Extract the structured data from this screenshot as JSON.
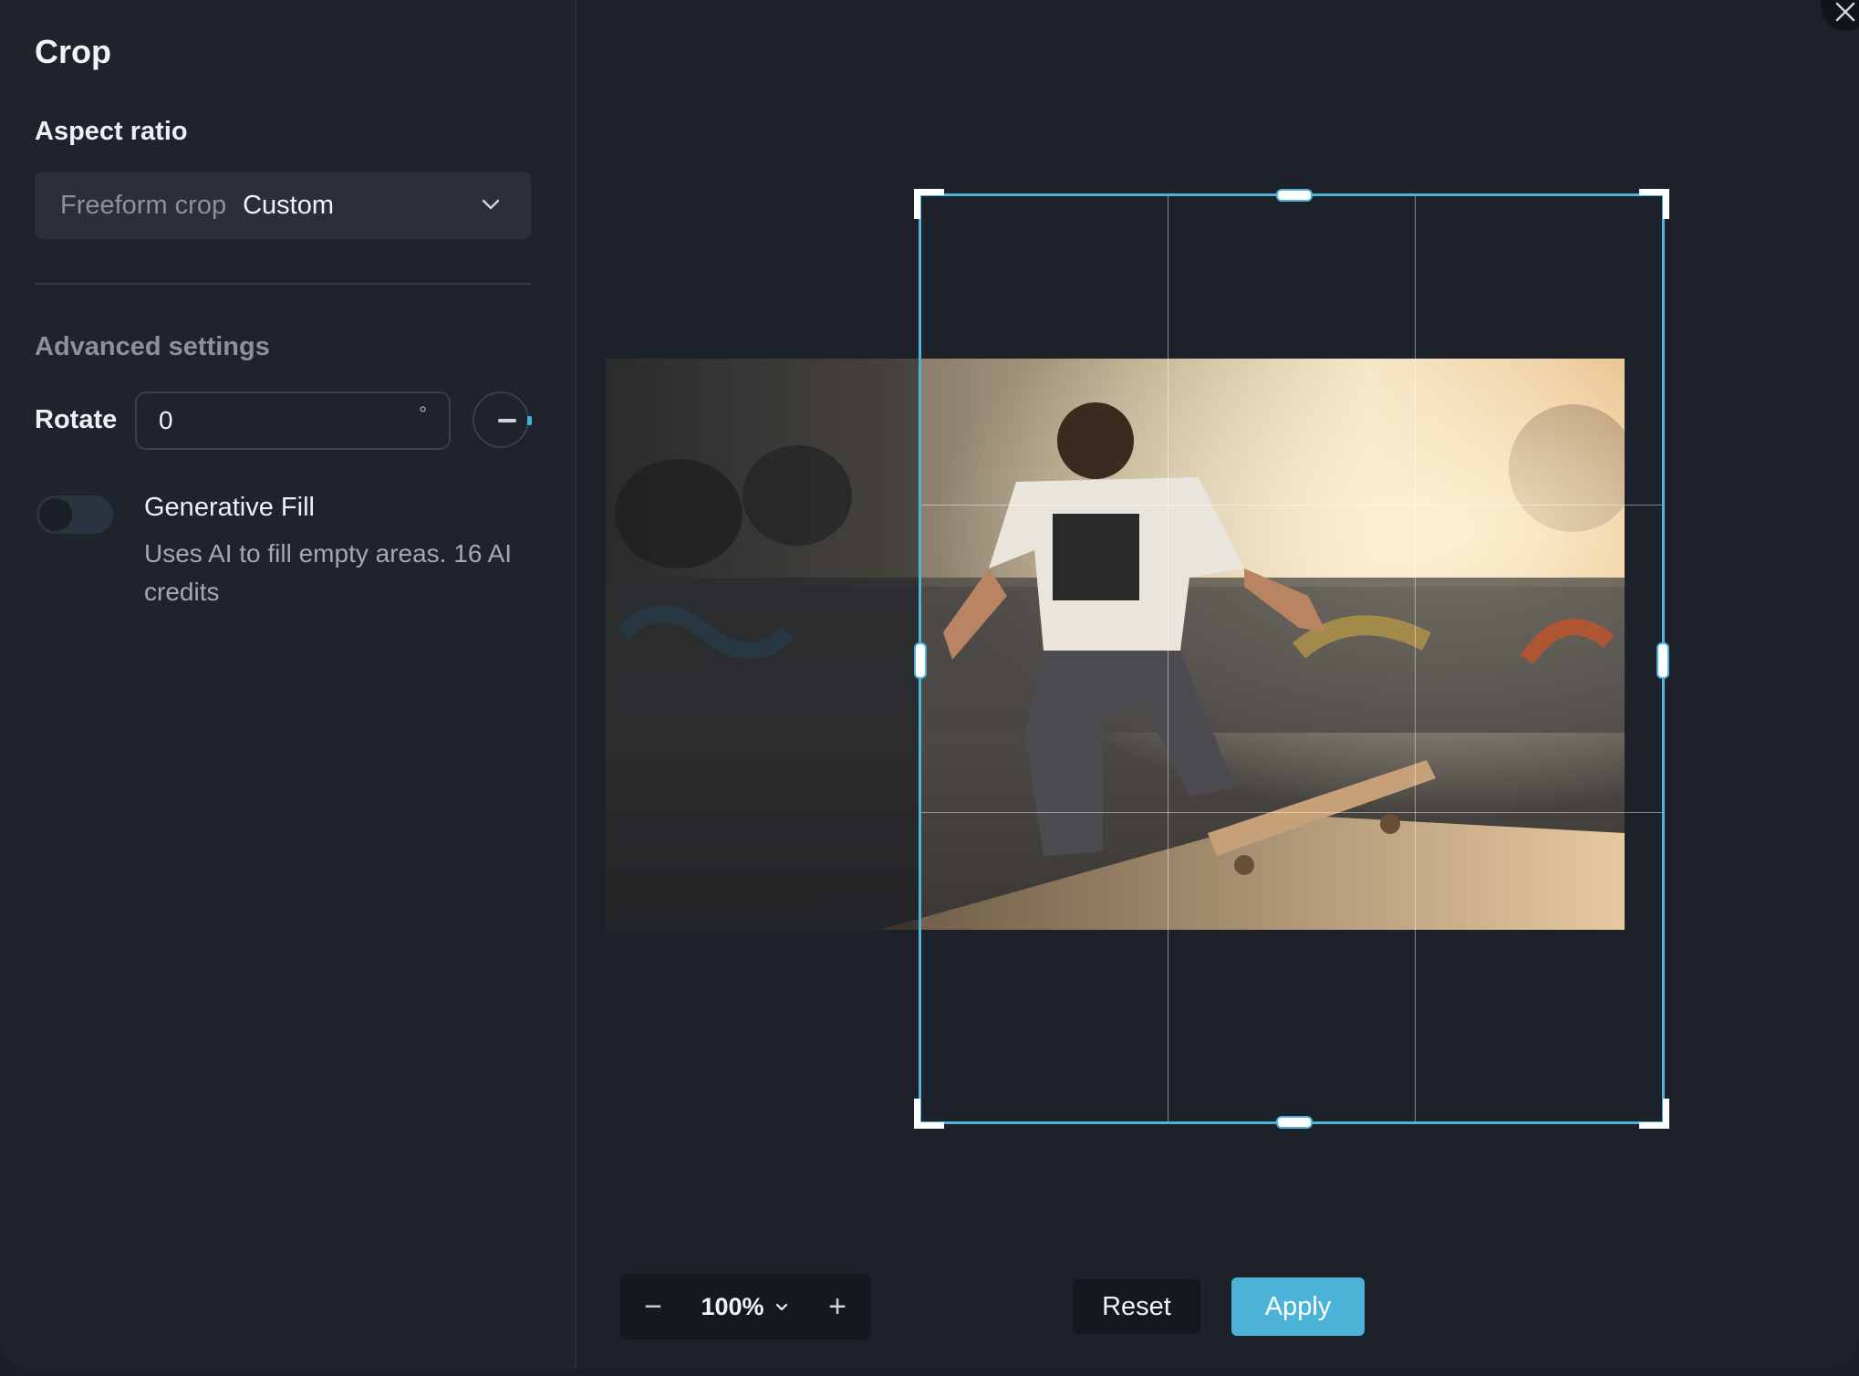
{
  "panel": {
    "title": "Crop",
    "aspect_label": "Aspect ratio",
    "aspect_prefix": "Freeform crop",
    "aspect_value": "Custom",
    "advanced_label": "Advanced settings",
    "rotate_label": "Rotate",
    "rotate_value": "0",
    "rotate_unit": "°",
    "generative_fill": {
      "title": "Generative Fill",
      "description": "Uses AI to fill empty areas. 16 AI credits",
      "enabled": false
    }
  },
  "toolbar": {
    "zoom_minus": "−",
    "zoom_value": "100%",
    "zoom_plus": "+",
    "reset_label": "Reset",
    "apply_label": "Apply"
  },
  "icons": {
    "close": "close-icon",
    "chevron": "chevron-down-icon",
    "rotate_dial": "rotate-dial-icon"
  },
  "colors": {
    "accent": "#4cb2d8",
    "background": "#1f232b",
    "crop_border": "#4fb3d9"
  }
}
